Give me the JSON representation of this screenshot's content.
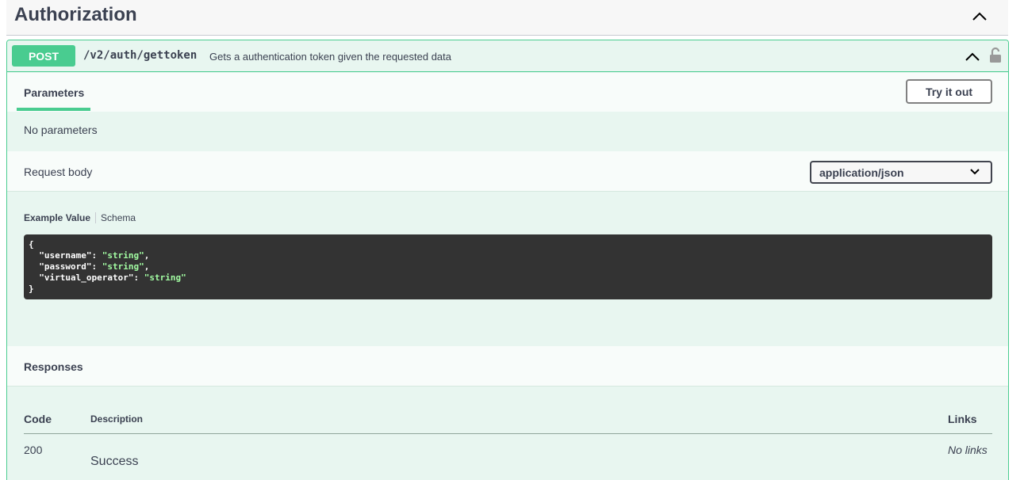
{
  "section": {
    "title": "Authorization",
    "toggle_icon": "chevron-up-icon"
  },
  "operation": {
    "method": "POST",
    "path": "/v2/auth/gettoken",
    "summary": "Gets a authentication token given the requested data",
    "colors": {
      "accent": "#49cc90",
      "background": "#e8f6f0"
    }
  },
  "parameters": {
    "tab_label": "Parameters",
    "try_button": "Try it out",
    "empty_text": "No parameters"
  },
  "request_body": {
    "label": "Request body",
    "content_type": "application/json",
    "model_tabs": {
      "example": "Example Value",
      "schema": "Schema"
    },
    "example_lines": [
      {
        "key": "\"username\"",
        "value": "\"string\"",
        "trail": ","
      },
      {
        "key": "\"password\"",
        "value": "\"string\"",
        "trail": ","
      },
      {
        "key": "\"virtual_operator\"",
        "value": "\"string\"",
        "trail": ""
      }
    ],
    "open_brace": "{",
    "close_brace": "}"
  },
  "responses": {
    "title": "Responses",
    "columns": {
      "code": "Code",
      "description": "Description",
      "links": "Links"
    },
    "rows": [
      {
        "code": "200",
        "description": "Success",
        "links": "No links"
      }
    ]
  }
}
